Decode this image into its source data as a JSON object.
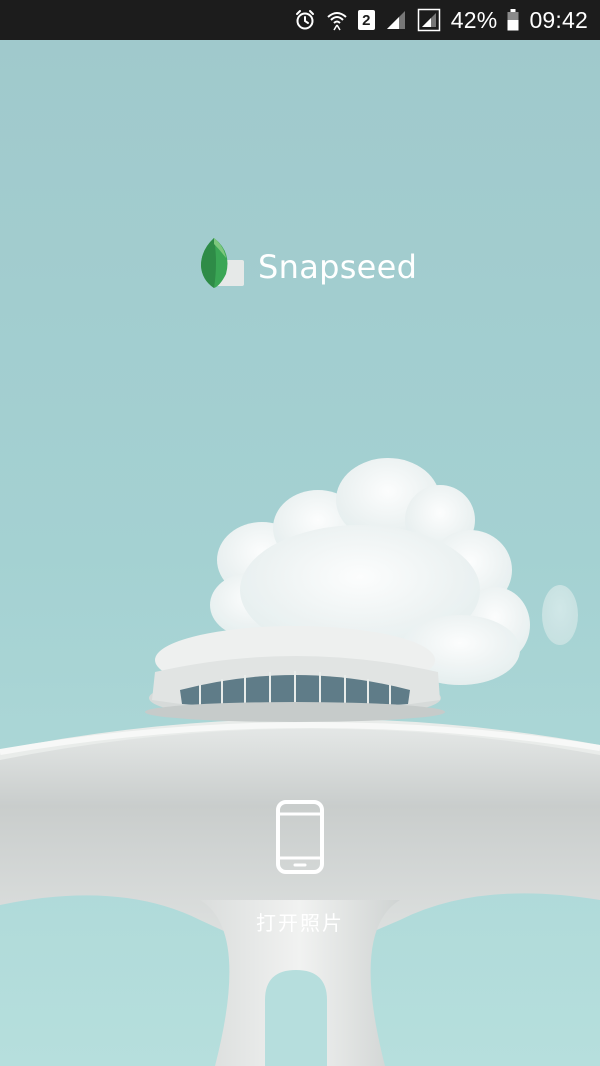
{
  "status_bar": {
    "sim_slot": "2",
    "battery_percent": "42%",
    "time": "09:42",
    "icons": [
      "alarm-icon",
      "wifi-icon",
      "sim-badge",
      "signal-icon",
      "signal-icon-2",
      "battery-icon"
    ]
  },
  "app": {
    "name": "Snapseed",
    "logo_icon": "snapseed-leaf-icon"
  },
  "main": {
    "open_photo_label": "打开照片",
    "open_photo_icon": "phone-icon"
  },
  "colors": {
    "sky": "#a4d0d2",
    "status_bar": "#1c1c1c",
    "leaf_green": "#3aa655",
    "text": "#ffffff"
  }
}
